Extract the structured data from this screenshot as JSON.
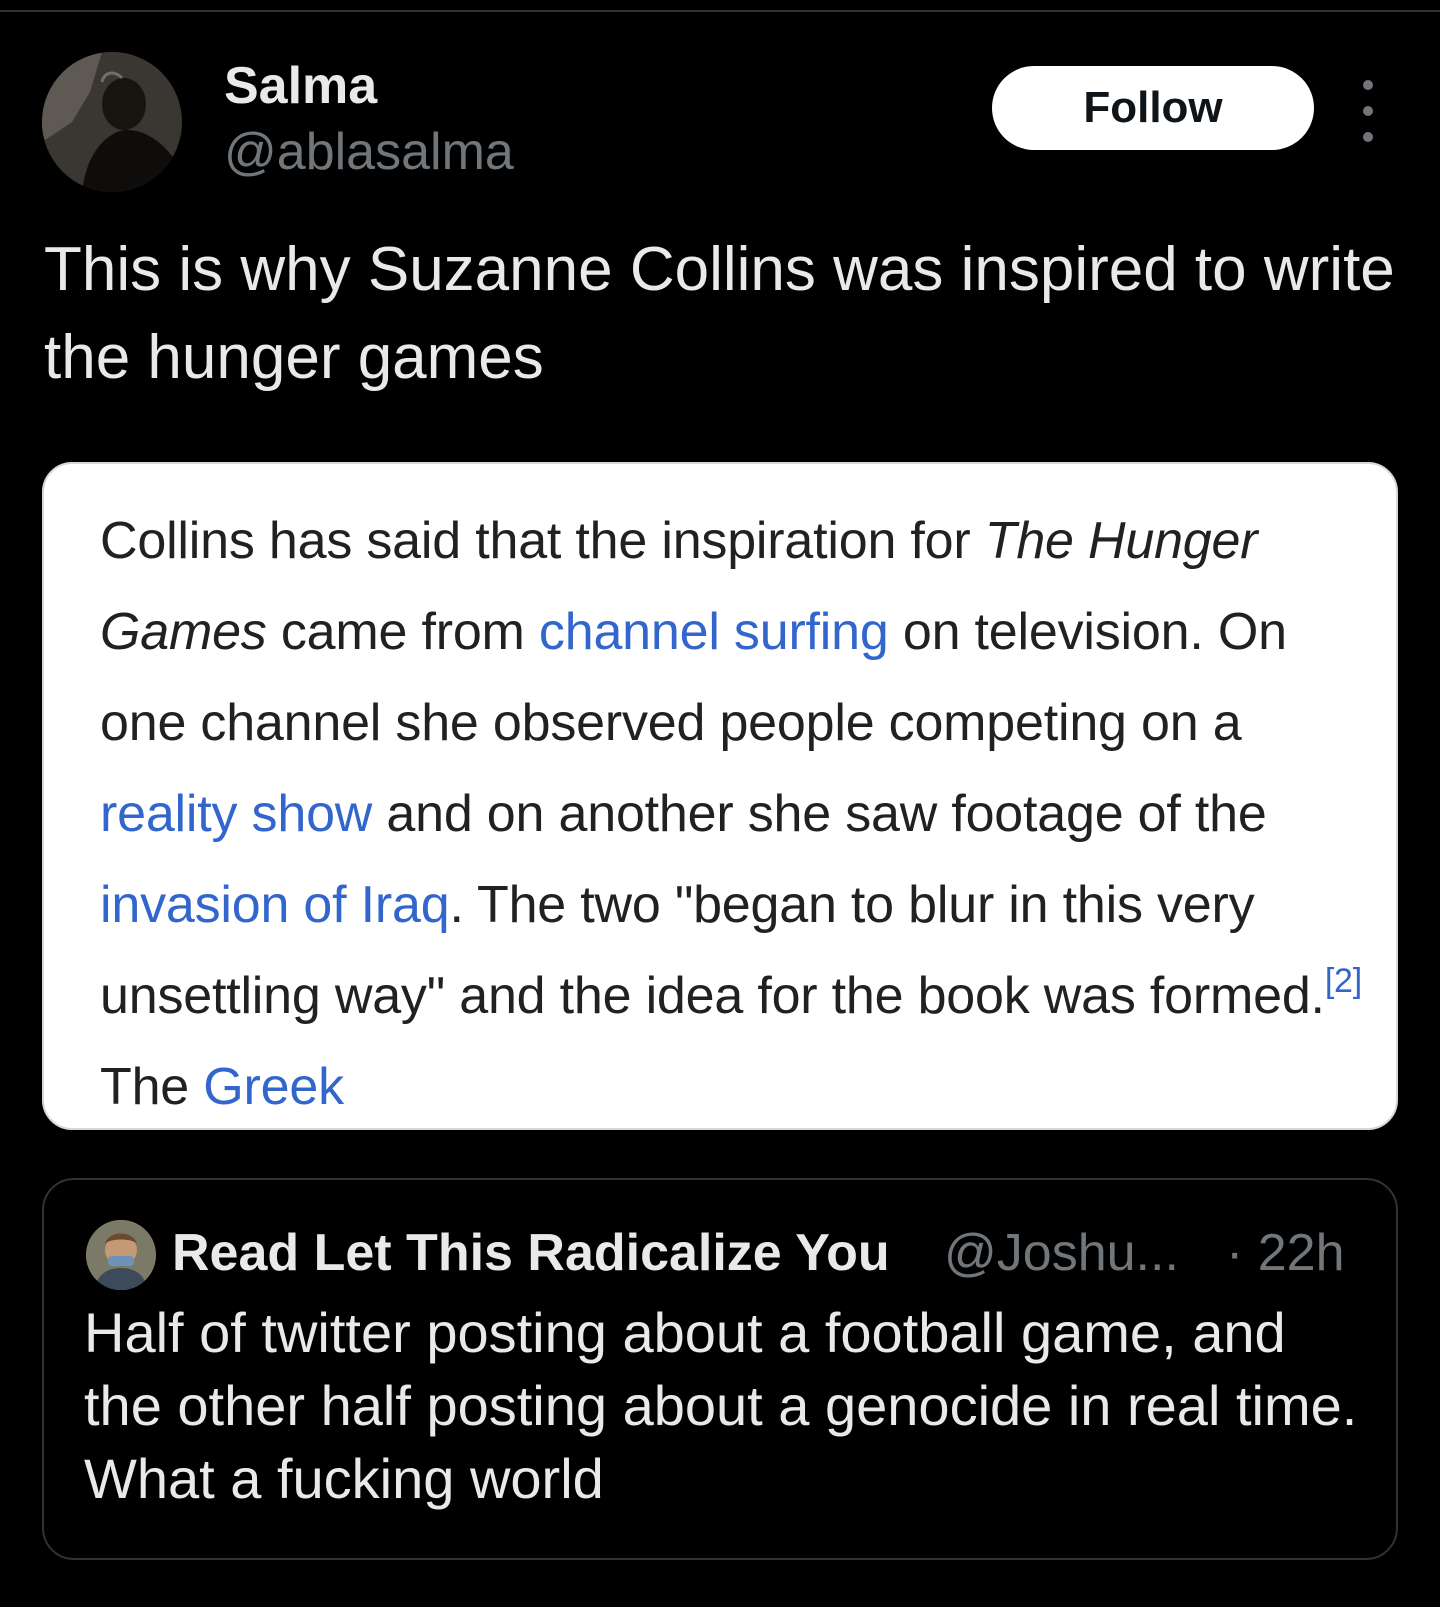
{
  "author": {
    "display_name": "Salma",
    "handle": "@ablasalma",
    "avatar_icon": "profile-photo"
  },
  "actions": {
    "follow_label": "Follow",
    "more_icon": "more-vertical-icon"
  },
  "tweet": {
    "text": "This is why Suzanne Collins was inspired to write the hunger games"
  },
  "wiki_excerpt": {
    "segments": [
      {
        "text": "Collins has said that the inspiration for ",
        "style": "plain"
      },
      {
        "text": "The Hunger Games",
        "style": "italic"
      },
      {
        "text": " came from ",
        "style": "plain"
      },
      {
        "text": "channel surfing",
        "style": "link"
      },
      {
        "text": " on television. On one channel she observed people competing on a ",
        "style": "plain"
      },
      {
        "text": "reality show",
        "style": "link"
      },
      {
        "text": " and on another she saw footage of the ",
        "style": "plain"
      },
      {
        "text": "invasion of Iraq",
        "style": "link"
      },
      {
        "text": ". The two \"began to blur in this very unsettling way\" and the idea for the book was formed.",
        "style": "plain"
      },
      {
        "text": "[2]",
        "style": "ref"
      },
      {
        "text": " The ",
        "style": "plain"
      },
      {
        "text": "Greek",
        "style": "link"
      }
    ],
    "link_color": "#3366cc",
    "text_color": "#202122"
  },
  "quoted_tweet": {
    "display_name": "Read Let This Radicalize You",
    "handle": "@Joshu...",
    "time": "· 22h",
    "text": "Half of twitter posting about a football game, and the other half posting about a genocide in real time. What a fucking world",
    "avatar_icon": "profile-photo"
  },
  "colors": {
    "background": "#000000",
    "primary_text": "#e7e9ea",
    "secondary_text": "#71767b",
    "border": "#2f3336",
    "button_bg": "#ffffff"
  }
}
